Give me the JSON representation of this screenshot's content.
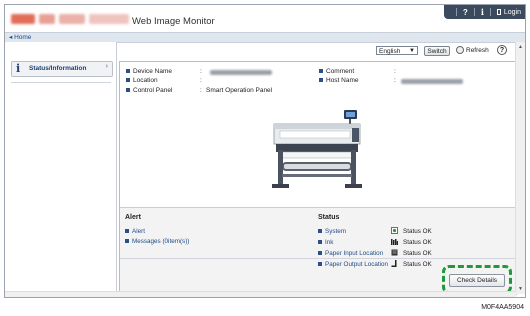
{
  "header": {
    "app_title": "Web Image Monitor",
    "help_label": "?",
    "info_label": "i",
    "login_label": "Login"
  },
  "breadcrumb": {
    "home": "Home"
  },
  "sidebar": {
    "items": [
      {
        "label": "Status/Information",
        "icon": "info-icon"
      }
    ]
  },
  "toolbar": {
    "language_value": "English",
    "switch_label": "Switch",
    "refresh_label": "Refresh",
    "help_label": "?"
  },
  "device_info": {
    "left": [
      {
        "label": "Device Name",
        "sep": ":",
        "value": ""
      },
      {
        "label": "Location",
        "sep": ":",
        "value": ""
      },
      {
        "label": "Control Panel",
        "sep": ":",
        "value": "Smart Operation Panel"
      }
    ],
    "right": [
      {
        "label": "Comment",
        "sep": ":",
        "value": ""
      },
      {
        "label": "Host Name",
        "sep": ":",
        "value": ""
      }
    ]
  },
  "alert": {
    "title": "Alert",
    "items": [
      "Alert",
      "Messages (0item(s))"
    ]
  },
  "status": {
    "title": "Status",
    "items": [
      {
        "label": "System",
        "value": "Status OK",
        "icon": "system-ok-icon"
      },
      {
        "label": "Ink",
        "value": "Status OK",
        "icon": "ink-icon"
      },
      {
        "label": "Paper Input Location",
        "value": "Status OK",
        "icon": "paper-input-icon"
      },
      {
        "label": "Paper Output Location",
        "value": "Status OK",
        "icon": "paper-output-icon"
      }
    ]
  },
  "check_details_label": "Check Details",
  "caption": "M0F4AA5904",
  "colors": {
    "highlight": "#1e9a3a",
    "header_dark": "#3b4a5c",
    "link": "#1f4a86"
  }
}
